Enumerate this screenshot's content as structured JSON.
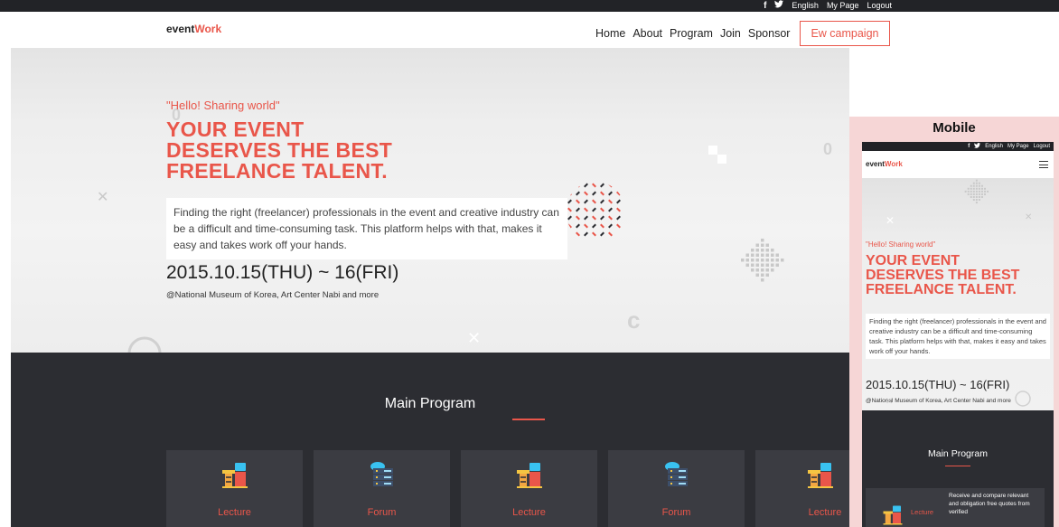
{
  "topbar": {
    "facebook_icon": "f",
    "twitter_icon": "🐦",
    "language": "English",
    "my_page": "My Page",
    "logout": "Logout"
  },
  "header": {
    "logo_part1": "event",
    "logo_part2": "Work",
    "nav": [
      "Home",
      "About",
      "Program",
      "Join",
      "Sponsor"
    ],
    "campaign": "Ew campaign"
  },
  "hero": {
    "hello": "\"Hello! Sharing world\"",
    "headline_lines": [
      "YOUR EVENT",
      "DESERVES THE BEST",
      "FREELANCE TALENT."
    ],
    "description": "Finding the right (freelancer) professionals in the event and creative industry can be a difficult and time-consuming task. This platform helps with that, makes it easy and takes work off your hands.",
    "date": "2015.10.15(THU) ~ 16(FRI)",
    "venue": "@National Museum of Korea, Art Center Nabi and more"
  },
  "program": {
    "title": "Main Program",
    "cards": [
      {
        "label": "Lecture",
        "icon": "desk-icon"
      },
      {
        "label": "Forum",
        "icon": "server-icon"
      },
      {
        "label": "Lecture",
        "icon": "desk-icon"
      },
      {
        "label": "Forum",
        "icon": "server-icon"
      },
      {
        "label": "Lecture",
        "icon": "desk-icon"
      }
    ]
  },
  "mobile": {
    "label": "Mobile",
    "topbar": {
      "language": "English",
      "my_page": "My Page",
      "logout": "Logout"
    },
    "logo_part1": "event",
    "logo_part2": "Work",
    "hello": "\"Hello! Sharing world\"",
    "headline_lines": [
      "YOUR EVENT",
      "DESERVES THE BEST",
      "FREELANCE TALENT."
    ],
    "description": "Finding the right (freelancer) professionals in the event and creative industry can be a difficult and time-consuming task. This platform helps with that, makes it easy and takes work off your hands.",
    "date": "2015.10.15(THU) ~ 16(FRI)",
    "venue": "@National Museum of Korea, Art Center Nabi and more",
    "program_title": "Main Program",
    "card": {
      "label": "Lecture",
      "description": "Receive and compare relevant and obligation free quotes from verified"
    }
  },
  "colors": {
    "accent": "#e9564a",
    "dark": "#2c2d32",
    "card": "#3b3c42",
    "mobile_frame": "#f6d6d6"
  }
}
